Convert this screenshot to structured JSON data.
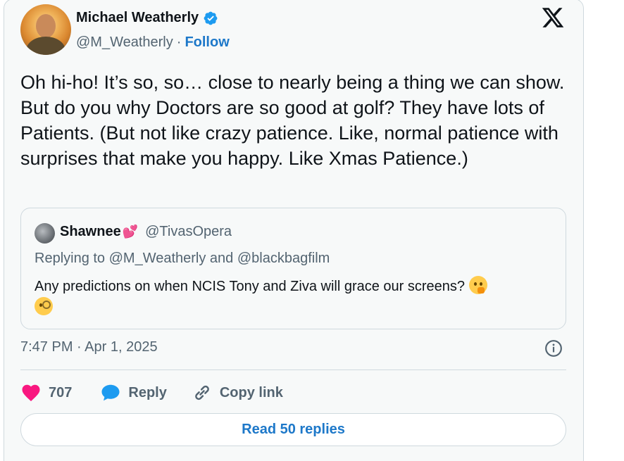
{
  "author": {
    "name": "Michael Weatherly",
    "handle": "@M_Weatherly",
    "separator": "·",
    "follow_label": "Follow"
  },
  "tweet": {
    "text": "Oh hi-ho! It’s so, so… close to nearly being a thing we can show. But do you why Doctors are so good at golf? They have lots of Patients. (But not like crazy patience. Like, normal patience with surprises that make you happy. Like Xmas Patience.)"
  },
  "quote": {
    "name": "Shawnee",
    "name_emoji": "💕",
    "handle": "@TivasOpera",
    "replying_to": "Replying to @M_Weatherly and @blackbagfilm",
    "text": "Any predictions on when NCIS Tony and Ziva will grace our screens?",
    "emojis": [
      "thinking-face",
      "face-with-monocle"
    ]
  },
  "timestamp": "7:47 PM · Apr 1, 2025",
  "actions": {
    "like_count": "707",
    "reply_label": "Reply",
    "copy_link_label": "Copy link"
  },
  "read_replies_label": "Read 50 replies",
  "colors": {
    "accent": "#1d78c9",
    "heart": "#f91880",
    "verified": "#1d9bf0",
    "muted_text": "#536471"
  }
}
